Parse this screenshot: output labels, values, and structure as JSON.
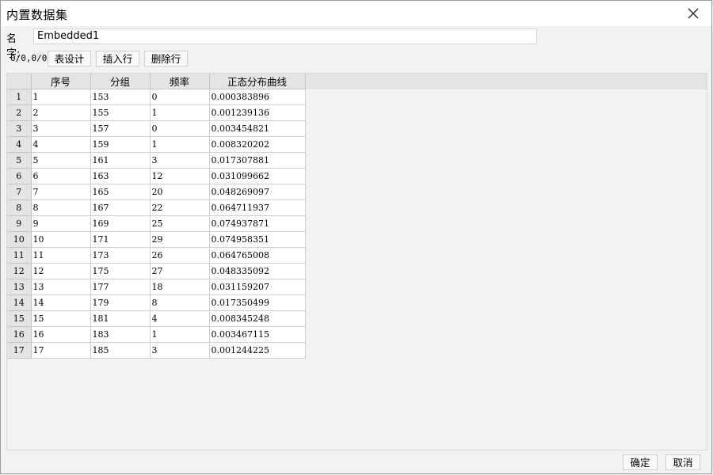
{
  "window": {
    "title": "内置数据集"
  },
  "name_field": {
    "label": "名字:",
    "value": "Embedded1"
  },
  "toolbar": {
    "position": "0/0,0/0",
    "table_design_label": "表设计",
    "insert_row_label": "插入行",
    "delete_row_label": "删除行"
  },
  "table": {
    "columns": [
      "序号",
      "分组",
      "频率",
      "正态分布曲线"
    ],
    "rows": [
      [
        "1",
        "1",
        "153",
        "0",
        "0.000383896"
      ],
      [
        "2",
        "2",
        "155",
        "1",
        "0.001239136"
      ],
      [
        "3",
        "3",
        "157",
        "0",
        "0.003454821"
      ],
      [
        "4",
        "4",
        "159",
        "1",
        "0.008320202"
      ],
      [
        "5",
        "5",
        "161",
        "3",
        "0.017307881"
      ],
      [
        "6",
        "6",
        "163",
        "12",
        "0.031099662"
      ],
      [
        "7",
        "7",
        "165",
        "20",
        "0.048269097"
      ],
      [
        "8",
        "8",
        "167",
        "22",
        "0.064711937"
      ],
      [
        "9",
        "9",
        "169",
        "25",
        "0.074937871"
      ],
      [
        "10",
        "10",
        "171",
        "29",
        "0.074958351"
      ],
      [
        "11",
        "11",
        "173",
        "26",
        "0.064765008"
      ],
      [
        "12",
        "12",
        "175",
        "27",
        "0.048335092"
      ],
      [
        "13",
        "13",
        "177",
        "18",
        "0.031159207"
      ],
      [
        "14",
        "14",
        "179",
        "8",
        "0.017350499"
      ],
      [
        "15",
        "15",
        "181",
        "4",
        "0.008345248"
      ],
      [
        "16",
        "16",
        "183",
        "1",
        "0.003467115"
      ],
      [
        "17",
        "17",
        "185",
        "3",
        "0.001244225"
      ]
    ]
  },
  "footer": {
    "ok_label": "确定",
    "cancel_label": "取消"
  },
  "icons": {
    "close": "close-icon"
  }
}
